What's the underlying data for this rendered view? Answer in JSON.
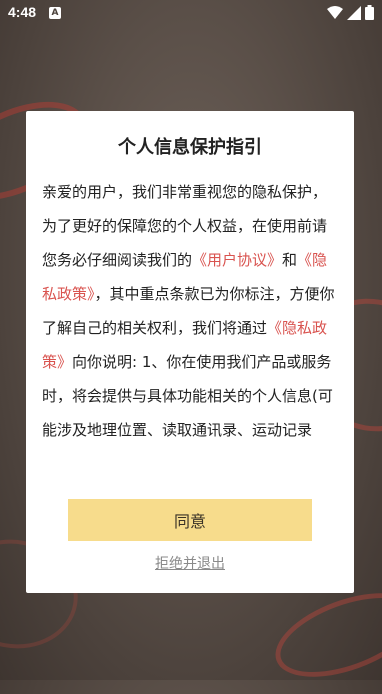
{
  "status_bar": {
    "time": "4:48",
    "notification_letter": "A",
    "icons": [
      "wifi-icon",
      "signal-icon",
      "battery-icon"
    ]
  },
  "dialog": {
    "title": "个人信息保护指引",
    "body": {
      "p1": "亲爱的用户，我们非常重视您的隐私保护，为了更好的保障您的个人权益，在使用前请您务必仔细阅读我们的",
      "link_user_agreement": "《用户协议》",
      "p2": "和",
      "link_privacy_policy": "《隐私政策》",
      "p3": "，其中重点条款已为你标注，方便你了解自己的相关权利，我们将通过",
      "link_privacy_policy_2": "《隐私政策》",
      "p4": "向你说明: 1、你在使用我们产品或服务时，将会提供与具体功能相关的个人信息(可能涉及地理位置、读取通讯录、运动记录"
    },
    "agree_label": "同意",
    "refuse_label": "拒绝并退出"
  },
  "colors": {
    "link": "#d9534f",
    "agree_button": "#f7dc8c"
  }
}
